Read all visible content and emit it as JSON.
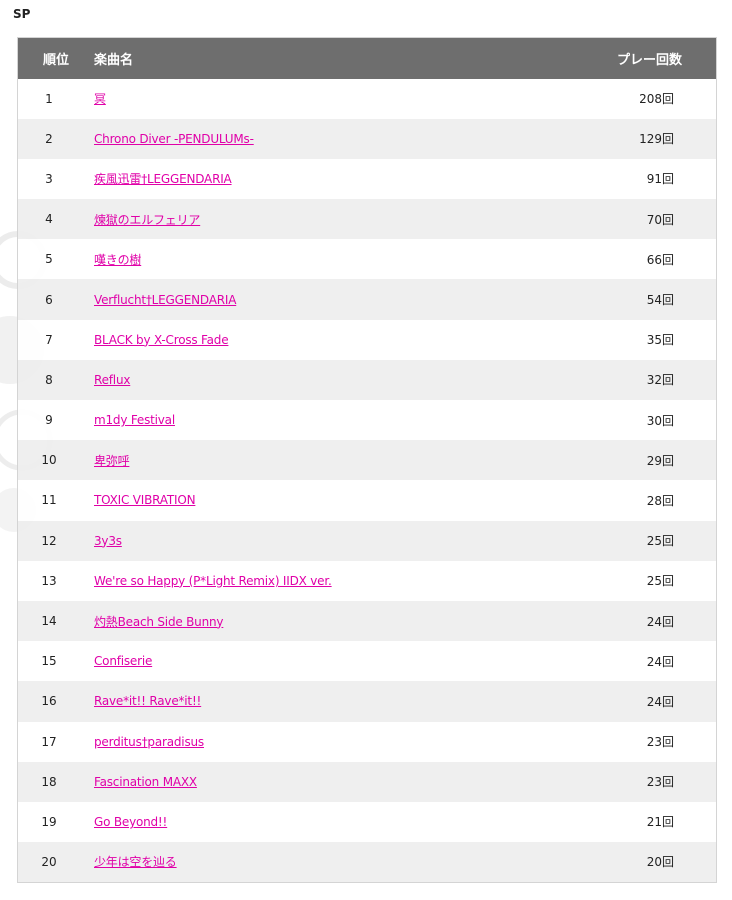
{
  "section_title": "SP",
  "table": {
    "headers": {
      "rank": "順位",
      "song": "楽曲名",
      "play_count": "プレー回数"
    },
    "rows": [
      {
        "rank": "1",
        "song": "冥",
        "count": "208回"
      },
      {
        "rank": "2",
        "song": "Chrono Diver -PENDULUMs-",
        "count": "129回"
      },
      {
        "rank": "3",
        "song": "疾風迅雷†LEGGENDARIA",
        "count": "91回"
      },
      {
        "rank": "4",
        "song": "煉獄のエルフェリア",
        "count": "70回"
      },
      {
        "rank": "5",
        "song": "嘆きの樹",
        "count": "66回"
      },
      {
        "rank": "6",
        "song": "Verflucht†LEGGENDARIA",
        "count": "54回"
      },
      {
        "rank": "7",
        "song": "BLACK by X-Cross Fade",
        "count": "35回"
      },
      {
        "rank": "8",
        "song": "Reflux",
        "count": "32回"
      },
      {
        "rank": "9",
        "song": "m1dy Festival",
        "count": "30回"
      },
      {
        "rank": "10",
        "song": "卑弥呼",
        "count": "29回"
      },
      {
        "rank": "11",
        "song": "TOXIC VIBRATION",
        "count": "28回"
      },
      {
        "rank": "12",
        "song": "3y3s",
        "count": "25回"
      },
      {
        "rank": "13",
        "song": "We're so Happy (P*Light Remix) IIDX ver.",
        "count": "25回"
      },
      {
        "rank": "14",
        "song": "灼熱Beach Side Bunny",
        "count": "24回"
      },
      {
        "rank": "15",
        "song": "Confiserie",
        "count": "24回"
      },
      {
        "rank": "16",
        "song": "Rave*it!! Rave*it!!",
        "count": "24回"
      },
      {
        "rank": "17",
        "song": "perditus†paradisus",
        "count": "23回"
      },
      {
        "rank": "18",
        "song": "Fascination MAXX",
        "count": "23回"
      },
      {
        "rank": "19",
        "song": "Go Beyond!!",
        "count": "21回"
      },
      {
        "rank": "20",
        "song": "少年は空を辿る",
        "count": "20回"
      }
    ]
  },
  "colors": {
    "header_bg": "#6e6e6e",
    "link": "#e000a8",
    "row_alt": "#eeeeee"
  }
}
